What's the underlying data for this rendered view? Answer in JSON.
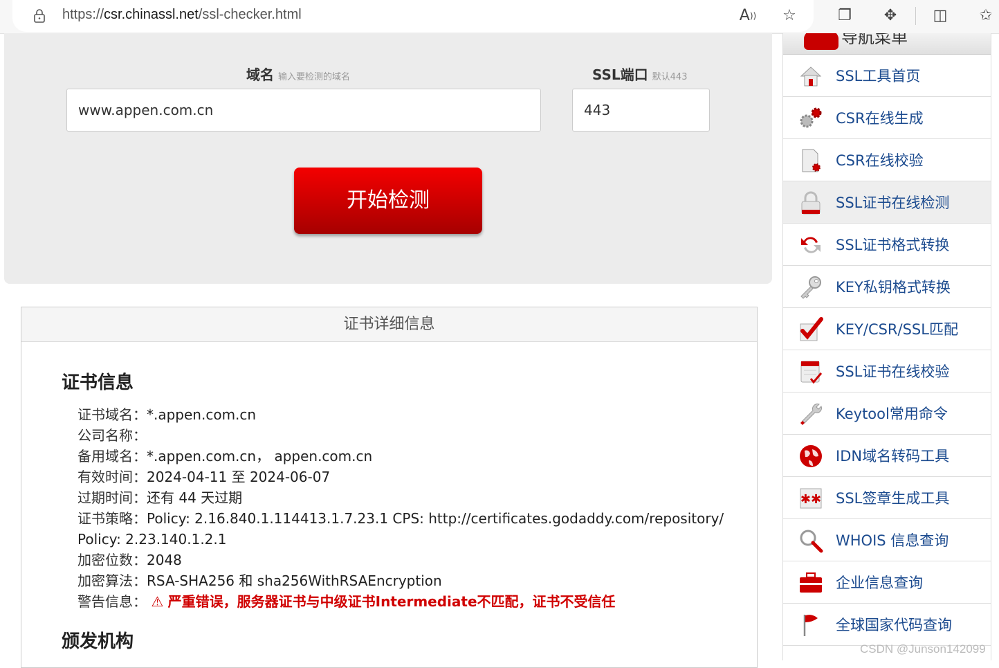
{
  "browser": {
    "url_prefix": "https://",
    "url_domain": "csr.chinassl.net",
    "url_path": "/ssl-checker.html",
    "icons": [
      "lock-icon",
      "read-aloud-icon",
      "favorite-icon",
      "collections-icon",
      "extensions-icon",
      "split-screen-icon",
      "favorites-bar-icon"
    ]
  },
  "form": {
    "domain_label": "域名",
    "domain_hint": "输入要检测的域名",
    "domain_value": "www.appen.com.cn",
    "port_label": "SSL端口",
    "port_hint": "默认443",
    "port_value": "443",
    "submit_label": "开始检测"
  },
  "detail": {
    "header": "证书详细信息",
    "cert_section_title": "证书信息",
    "rows": [
      {
        "key": "证书域名：",
        "value": "*.appen.com.cn"
      },
      {
        "key": "公司名称：",
        "value": ""
      },
      {
        "key": "备用域名：",
        "value": "*.appen.com.cn， appen.com.cn"
      },
      {
        "key": "有效时间：",
        "value": "2024-04-11 至 2024-06-07"
      },
      {
        "key": "过期时间：",
        "value": "还有 44 天过期"
      },
      {
        "key": "证书策略：",
        "value": "Policy: 2.16.840.1.114413.1.7.23.1 CPS: http://certificates.godaddy.com/repository/"
      },
      {
        "key": "",
        "value": "Policy: 2.23.140.1.2.1"
      },
      {
        "key": "加密位数：",
        "value": "2048"
      },
      {
        "key": "加密算法：",
        "value": "RSA-SHA256 和 sha256WithRSAEncryption"
      }
    ],
    "warning_key": "警告信息：",
    "warning_text": "严重错误，服务器证书与中级证书Intermediate不匹配，证书不受信任",
    "issuer_section_title": "颁发机构"
  },
  "sidebar": {
    "title": "导航菜单",
    "items": [
      {
        "label": "SSL工具首页",
        "icon": "home-icon"
      },
      {
        "label": "CSR在线生成",
        "icon": "gears-icon"
      },
      {
        "label": "CSR在线校验",
        "icon": "document-gear-icon"
      },
      {
        "label": "SSL证书在线检测",
        "icon": "padlock-icon",
        "active": true
      },
      {
        "label": "SSL证书格式转换",
        "icon": "convert-arrows-icon"
      },
      {
        "label": "KEY私钥格式转换",
        "icon": "key-icon"
      },
      {
        "label": "KEY/CSR/SSL匹配",
        "icon": "checkmark-icon"
      },
      {
        "label": "SSL证书在线校验",
        "icon": "calendar-check-icon"
      },
      {
        "label": "Keytool常用命令",
        "icon": "wrench-icon"
      },
      {
        "label": "IDN域名转码工具",
        "icon": "globe-icon"
      },
      {
        "label": "SSL签章生成工具",
        "icon": "seal-icon"
      },
      {
        "label": "WHOIS 信息查询",
        "icon": "magnifier-icon"
      },
      {
        "label": "企业信息查询",
        "icon": "briefcase-icon"
      },
      {
        "label": "全球国家代码查询",
        "icon": "flag-icon"
      }
    ]
  },
  "watermark": "CSDN @Junson142099"
}
